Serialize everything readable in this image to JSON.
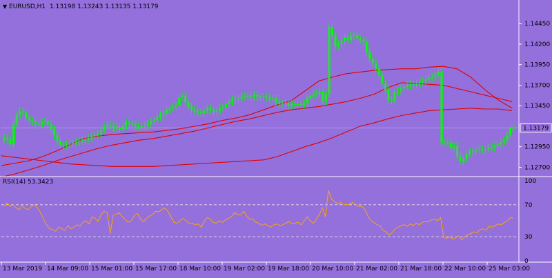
{
  "header": {
    "menu_glyph": "▼",
    "symbol_timeframe": "EURUSD,H1",
    "ohlc": "1.13198 1.13243 1.13135 1.13179"
  },
  "colors": {
    "background": "#9370DB",
    "candle": "#00FF00",
    "ma_line": "#E00000",
    "rsi_line": "#FFA500",
    "grid_dash": "#E6E6E6",
    "axis": "#FFFFFF",
    "price_tag_bg": "#9370DB"
  },
  "chart_data": [
    {
      "type": "candlestick",
      "title": "EURUSD,H1",
      "price_axis_labels": [
        "1.14450",
        "1.14200",
        "1.13950",
        "1.13700",
        "1.13450",
        "1.12950",
        "1.12700"
      ],
      "ylim": [
        1.1262,
        1.1462
      ],
      "current_price_label": "1.13179",
      "current_price": 1.13179,
      "closes": [
        1.1306,
        1.1304,
        1.1298,
        1.1322,
        1.1334,
        1.1338,
        1.1337,
        1.133,
        1.1327,
        1.1325,
        1.1323,
        1.1322,
        1.1325,
        1.1326,
        1.1322,
        1.1316,
        1.1309,
        1.1302,
        1.1297,
        1.1297,
        1.1298,
        1.1299,
        1.13,
        1.1301,
        1.1302,
        1.1303,
        1.1304,
        1.1306,
        1.1308,
        1.1309,
        1.1311,
        1.1315,
        1.132,
        1.1322,
        1.132,
        1.1318,
        1.1319,
        1.1316,
        1.132,
        1.1325,
        1.1323,
        1.1322,
        1.132,
        1.1319,
        1.132,
        1.1321,
        1.1323,
        1.1326,
        1.1328,
        1.1331,
        1.1334,
        1.1336,
        1.134,
        1.1342,
        1.1344,
        1.1346,
        1.1355,
        1.1357,
        1.1349,
        1.1344,
        1.134,
        1.1338,
        1.1337,
        1.1336,
        1.1339,
        1.1342,
        1.134,
        1.1338,
        1.1339,
        1.1342,
        1.1343,
        1.1347,
        1.135,
        1.1352,
        1.1353,
        1.1354,
        1.1356,
        1.1357,
        1.1357,
        1.1356,
        1.1358,
        1.1356,
        1.1355,
        1.1356,
        1.1355,
        1.1353,
        1.1354,
        1.1349,
        1.1347,
        1.1348,
        1.1347,
        1.1345,
        1.1347,
        1.1346,
        1.1347,
        1.1346,
        1.1348,
        1.1354,
        1.1357,
        1.1359,
        1.136,
        1.1362,
        1.135,
        1.1359,
        1.1441,
        1.143,
        1.1418,
        1.142,
        1.1424,
        1.1428,
        1.1425,
        1.143,
        1.1431,
        1.1427,
        1.1425,
        1.1423,
        1.141,
        1.1402,
        1.1397,
        1.139,
        1.1382,
        1.1372,
        1.1364,
        1.1352,
        1.1351,
        1.1362,
        1.1363,
        1.1366,
        1.1368,
        1.137,
        1.1371,
        1.137,
        1.1372,
        1.1374,
        1.1375,
        1.1377,
        1.1379,
        1.138,
        1.1382,
        1.1386,
        1.13,
        1.13,
        1.13,
        1.1293,
        1.1296,
        1.1283,
        1.1277,
        1.128,
        1.1286,
        1.1289,
        1.129,
        1.1291,
        1.1292,
        1.1291,
        1.1292,
        1.1294,
        1.1294,
        1.1296,
        1.1298,
        1.1301,
        1.1303,
        1.1309,
        1.1318,
        1.1318
      ],
      "moving_averages": [
        {
          "period": "fast",
          "values": [
            1.1272,
            1.1275,
            1.1278,
            1.1283,
            1.129,
            1.1298,
            1.1305,
            1.1308,
            1.131,
            1.1311,
            1.1312,
            1.1313,
            1.1315,
            1.1317,
            1.132,
            1.1323,
            1.1327,
            1.133,
            1.1334,
            1.134,
            1.1346,
            1.1351,
            1.1363,
            1.1375,
            1.138,
            1.1384,
            1.1386,
            1.1388,
            1.1389,
            1.139,
            1.139,
            1.1392,
            1.1393,
            1.139,
            1.138,
            1.1365,
            1.1352,
            1.1342
          ]
        },
        {
          "period": "medium",
          "values": [
            1.1258,
            1.1262,
            1.1267,
            1.1272,
            1.1278,
            1.1283,
            1.1288,
            1.1293,
            1.1297,
            1.13,
            1.1303,
            1.1305,
            1.1308,
            1.1311,
            1.1314,
            1.1318,
            1.1322,
            1.1326,
            1.1329,
            1.1333,
            1.1337,
            1.134,
            1.1342,
            1.1344,
            1.1347,
            1.135,
            1.1354,
            1.1359,
            1.1367,
            1.1373,
            1.1372,
            1.1371,
            1.137,
            1.1366,
            1.1362,
            1.1358,
            1.1354,
            1.135
          ]
        },
        {
          "period": "slow",
          "values": [
            1.1284,
            1.1282,
            1.128,
            1.1278,
            1.1276,
            1.1274,
            1.1273,
            1.1272,
            1.1271,
            1.1271,
            1.1271,
            1.1271,
            1.1272,
            1.1273,
            1.1274,
            1.1275,
            1.1276,
            1.1277,
            1.1278,
            1.1279,
            1.1283,
            1.1289,
            1.1295,
            1.13,
            1.1306,
            1.1313,
            1.132,
            1.1324,
            1.1329,
            1.1333,
            1.1336,
            1.1339,
            1.134,
            1.1341,
            1.1342,
            1.1341,
            1.1341,
            1.1339
          ]
        }
      ],
      "x_tick_labels": [
        "13 Mar 2019",
        "14 Mar 09:00",
        "15 Mar 01:00",
        "15 Mar 17:00",
        "18 Mar 10:00",
        "19 Mar 02:00",
        "19 Mar 18:00",
        "20 Mar 10:00",
        "21 Mar 02:00",
        "21 Mar 18:00",
        "22 Mar 10:00",
        "25 Mar 03:00"
      ]
    },
    {
      "type": "line",
      "title": "RSI(14) 53.3423",
      "indicator_label": "RSI(14) 53.3423",
      "rsi_axis_labels": [
        "100",
        "70",
        "30",
        "0"
      ],
      "levels": [
        70,
        30
      ],
      "ylim": [
        0,
        100
      ],
      "values": [
        68,
        72,
        68,
        70,
        66,
        64,
        69,
        65,
        64,
        68,
        70,
        66,
        60,
        52,
        45,
        40,
        39,
        37,
        42,
        40,
        38,
        44,
        40,
        42,
        45,
        43,
        48,
        50,
        46,
        55,
        53,
        49,
        58,
        62,
        60,
        34,
        57,
        58,
        60,
        55,
        51,
        48,
        50,
        57,
        59,
        52,
        49,
        53,
        56,
        58,
        62,
        61,
        64,
        66,
        62,
        55,
        48,
        47,
        50,
        53,
        50,
        47,
        47,
        45,
        46,
        42,
        49,
        54,
        52,
        48,
        47,
        50,
        48,
        51,
        53,
        55,
        60,
        58,
        57,
        62,
        56,
        52,
        52,
        48,
        47,
        44,
        46,
        44,
        42,
        45,
        46,
        44,
        45,
        47,
        49,
        46,
        47,
        48,
        45,
        50,
        55,
        50,
        47,
        52,
        58,
        66,
        55,
        88,
        77,
        74,
        71,
        73,
        70,
        70,
        71,
        73,
        70,
        68,
        68,
        64,
        56,
        50,
        48,
        45,
        44,
        38,
        36,
        32,
        35,
        40,
        42,
        44,
        45,
        43,
        46,
        44,
        47,
        45,
        48,
        49,
        49,
        51,
        52,
        50,
        54,
        29,
        28,
        30,
        27,
        29,
        31,
        26,
        30,
        33,
        34,
        36,
        35,
        39,
        40,
        38,
        43,
        42,
        44,
        46,
        45,
        48,
        50,
        54,
        53
      ]
    }
  ]
}
